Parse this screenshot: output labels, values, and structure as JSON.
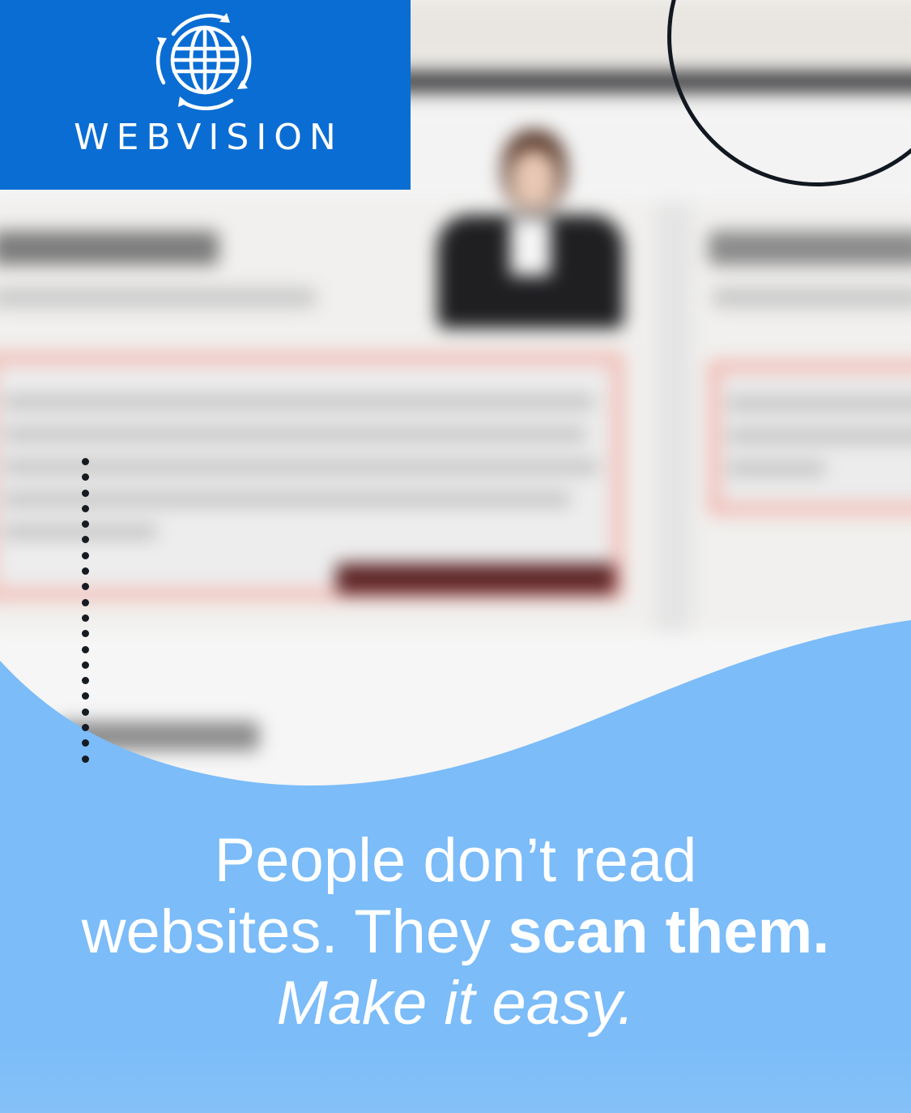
{
  "brand": {
    "name": "WEBVISION",
    "logo_icon": "globe-with-circular-arrows-icon",
    "block_color": "#0a6dd3"
  },
  "tagline": {
    "line1": "People don’t read",
    "line2_regular": "websites. They ",
    "line2_bold": "scan them.",
    "line3_italic": "Make it easy."
  },
  "colors": {
    "accent_blue": "#7bbcf9",
    "text": "#ffffff",
    "decor_dark": "#121820"
  }
}
